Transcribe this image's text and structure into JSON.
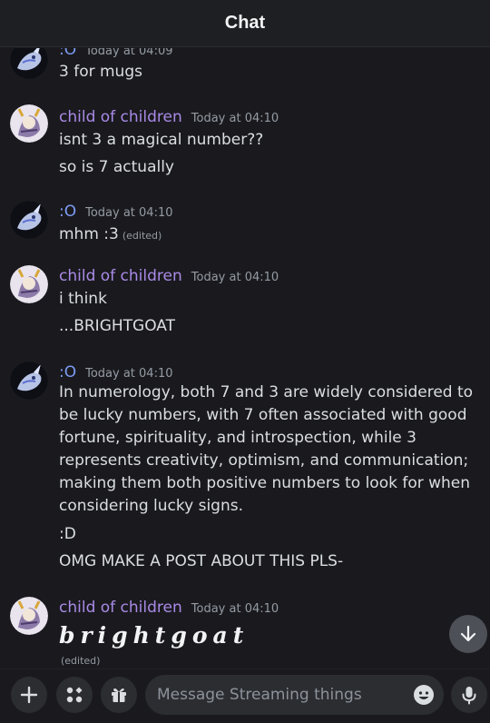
{
  "header": {
    "title": "Chat"
  },
  "messages": [
    {
      "author": ":O",
      "timestamp": "Today at 04:09",
      "lines": [
        "3 for mugs"
      ]
    },
    {
      "author": "child of children",
      "timestamp": "Today at 04:10",
      "lines": [
        "isnt 3 a magical number??",
        "so is 7 actually"
      ]
    },
    {
      "author": ":O",
      "timestamp": "Today at 04:10",
      "lines": [
        "mhm :3"
      ],
      "edited": "(edited)"
    },
    {
      "author": "child of children",
      "timestamp": "Today at 04:10",
      "lines": [
        "i think",
        "...BRIGHTGOAT"
      ]
    },
    {
      "author": ":O",
      "timestamp": "Today at 04:10",
      "paragraph": "In numerology, both 7 and 3 are widely considered to be lucky numbers, with 7 often associated with good fortune, spirituality, and introspection, while 3 represents creativity, optimism, and communication; making them both positive numbers to look for when considering lucky signs.",
      "lines": [
        ":D",
        "OMG MAKE A POST ABOUT THIS PLS-"
      ]
    },
    {
      "author": "child of children",
      "timestamp": "Today at 04:10",
      "big_text": "brightgoat",
      "edited": "(edited)"
    }
  ],
  "composer": {
    "placeholder": "Message Streaming things"
  },
  "colors": {
    "background": "#1a1a1e",
    "author_purple": "#a98ae6",
    "author_blue": "#7e9cf5",
    "timestamp": "#949ba4"
  },
  "icons": {
    "add": "plus-icon",
    "apps": "apps-icon",
    "gift": "gift-icon",
    "emoji": "emoji-icon",
    "mic": "microphone-icon",
    "jump": "arrow-down-icon"
  }
}
